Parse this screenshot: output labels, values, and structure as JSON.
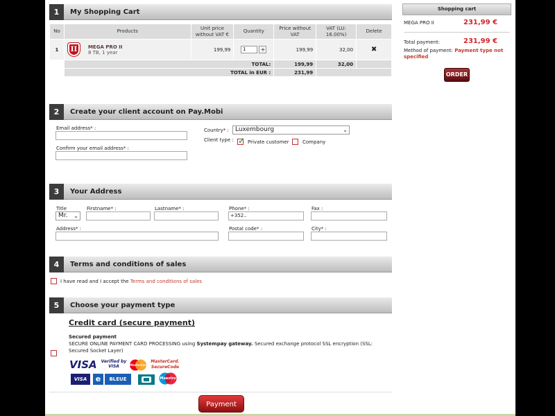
{
  "cart": {
    "num": "1",
    "title": "My Shopping Cart",
    "headers": [
      "No",
      "Products",
      "Unit price without VAT €",
      "Quantity",
      "Price without VAT",
      "VAT (LU: 16.00%)",
      "Delete"
    ],
    "row": {
      "no": "1",
      "logo_letter": "II",
      "name": "MEGA PRO II",
      "sub": "8 TB, 1 year",
      "unit_price": "199,99",
      "quantity": "1",
      "price": "199,99",
      "vat": "32,00"
    },
    "total_label": "TOTAL:",
    "total_price": "199,99",
    "total_vat": "32,00",
    "total_eur_label": "TOTAL in EUR :",
    "total_eur": "231,99"
  },
  "account": {
    "num": "2",
    "title": "Create your client account on Pay.Mobi",
    "email_label": "Email address* :",
    "confirm_label": "Confirm your email address* :",
    "country_label": "Country* :",
    "country_value": "Luxembourg",
    "client_type_label": "Client type :",
    "private_label": "Private customer",
    "company_label": "Company"
  },
  "address": {
    "num": "3",
    "title": "Your Address",
    "title_label": "Title",
    "title_value": "Mr.",
    "firstname_label": "Firstname* :",
    "lastname_label": "Lastname* :",
    "phone_label": "Phone* :",
    "phone_value": "+352..",
    "fax_label": "Fax :",
    "address_label": "Address* :",
    "postal_label": "Postal code* :",
    "city_label": "City* :"
  },
  "terms": {
    "num": "4",
    "title": "Terms and conditions of sales",
    "text": "I have read and I accept the",
    "link": "Terms and conditions of sales"
  },
  "payment": {
    "num": "5",
    "title": "Choose your payment type",
    "cc_title": "Credit card (secure payment)",
    "secured_title": "Secured payment",
    "desc_pre": "SECURE ONLINE PAYMENT CARD PROCESSING using",
    "desc_bold": "Systempay gateway.",
    "desc_post": "Secured exchange protocol SSL encryption (SSL: Secured Socket Layer)",
    "logos": {
      "visa": "VISA",
      "verified": "Verified by VISA",
      "mastercard": "MasterCard",
      "mc_secure": "MasterCard. SecureCode",
      "visa_small": "VISA",
      "e": "e",
      "bleue": "BLEUE",
      "maestro": "Maestro"
    },
    "button": "Payment"
  },
  "side": {
    "header": "Shopping cart",
    "item_name": "MEGA PRO II",
    "item_price": "231,99 €",
    "total_label": "Total payment:",
    "total_value": "231,99 €",
    "method_label": "Method of payment:",
    "method_value": "Payment type not specified",
    "order_button": "ORDER"
  },
  "colors": {
    "accent_red": "#d0262c",
    "header_dark": "#3c3c3c"
  }
}
